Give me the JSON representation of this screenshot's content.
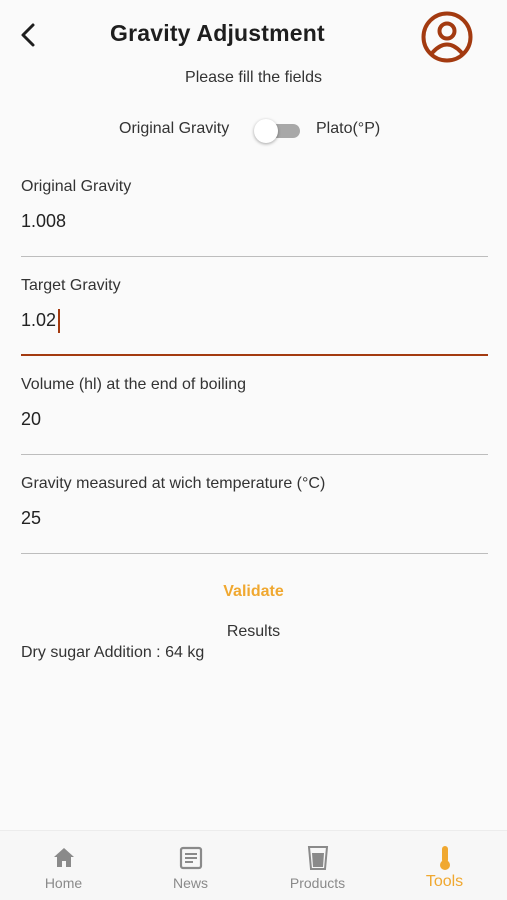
{
  "header": {
    "title": "Gravity Adjustment",
    "back_icon": "chevron-left-icon",
    "profile_icon": "user-circle-icon"
  },
  "subtitle": "Please fill the fields",
  "unit_toggle": {
    "left_label": "Original Gravity",
    "right_label": "Plato(°P)",
    "is_on": false
  },
  "fields": [
    {
      "label": "Original Gravity",
      "value": "1.008",
      "active": false
    },
    {
      "label": "Target Gravity",
      "value": "1.02",
      "active": true
    },
    {
      "label": "Volume (hl) at the end of boiling",
      "value": "20",
      "active": false
    },
    {
      "label": "Gravity measured at wich temperature (°C)",
      "value": "25",
      "active": false
    }
  ],
  "validate_label": "Validate",
  "results": {
    "title": "Results",
    "line": "Dry sugar Addition : 64 kg"
  },
  "bottom_nav": [
    {
      "label": "Home",
      "icon": "home-icon",
      "active": false
    },
    {
      "label": "News",
      "icon": "news-icon",
      "active": false
    },
    {
      "label": "Products",
      "icon": "glass-icon",
      "active": false
    },
    {
      "label": "Tools",
      "icon": "thermometer-icon",
      "active": true
    }
  ],
  "colors": {
    "accent": "#f0a830",
    "brand": "#a33a10",
    "inactive": "#8a8a8a"
  }
}
